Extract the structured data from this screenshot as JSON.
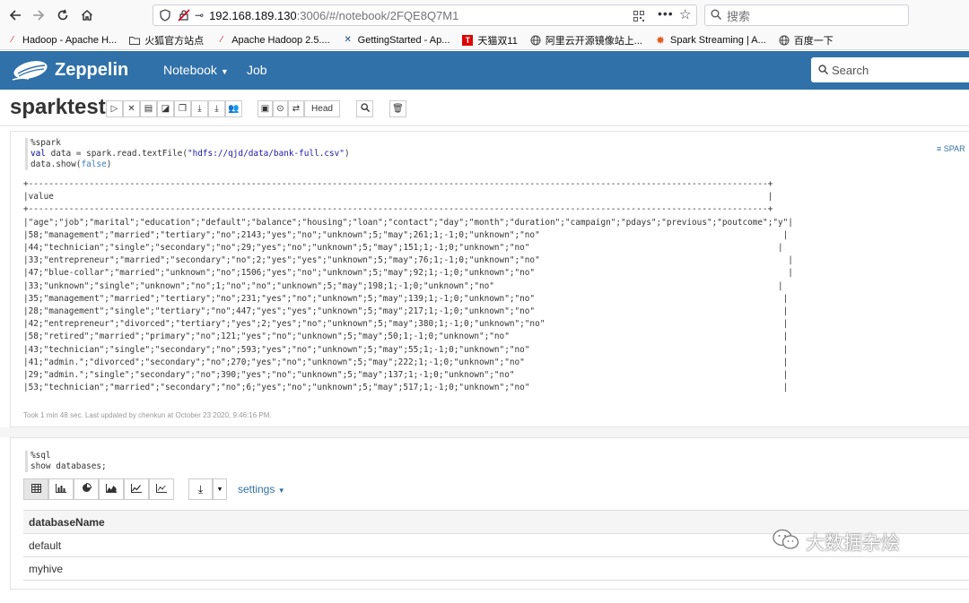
{
  "browser": {
    "url_host": "192.168.189.130",
    "url_path": ":3006/#/notebook/2FQE8Q7M1",
    "search_placeholder": "搜索",
    "bookmarks": [
      {
        "label": "Hadoop - Apache H...",
        "icon": "feather-icon"
      },
      {
        "label": "火狐官方站点",
        "icon": "folder-icon"
      },
      {
        "label": "Apache Hadoop 2.5....",
        "icon": "feather-icon"
      },
      {
        "label": "GettingStarted - Ap...",
        "icon": "x-icon"
      },
      {
        "label": "天猫双11",
        "icon": "tmall-icon"
      },
      {
        "label": "阿里云开源镜像站上...",
        "icon": "globe-icon"
      },
      {
        "label": "Spark Streaming | A...",
        "icon": "spark-icon"
      },
      {
        "label": "百度一下",
        "icon": "globe-icon"
      }
    ]
  },
  "zeppelin": {
    "title": "Zeppelin",
    "nav_notebook": "Notebook",
    "nav_job": "Job",
    "search_placeholder": "Search",
    "brand_color": "#3071a9"
  },
  "notebook": {
    "name": "sparktest",
    "head_button": "Head"
  },
  "para1": {
    "interpreter_label": "SPAR",
    "code": {
      "line1": "%spark",
      "line2_kw": "val",
      "line2_rest": " data = spark.read.textFile(",
      "line2_str": "\"hdfs://qjd/data/bank-full.csv\"",
      "line2_end": ")",
      "line3_pre": "data.show(",
      "line3_kw": "false",
      "line3_end": ")"
    },
    "output_lines": [
      "+--------------------------------------------------------------------------------------------------------------------------------------------------+",
      "|value                                                                                                                                             |",
      "+--------------------------------------------------------------------------------------------------------------------------------------------------+",
      "|\"age\";\"job\";\"marital\";\"education\";\"default\";\"balance\";\"housing\";\"loan\";\"contact\";\"day\";\"month\";\"duration\";\"campaign\";\"pdays\";\"previous\";\"poutcome\";\"y\"|",
      "|58;\"management\";\"married\";\"tertiary\";\"no\";2143;\"yes\";\"no\";\"unknown\";5;\"may\";261;1;-1;0;\"unknown\";\"no\"                                                |",
      "|44;\"technician\";\"single\";\"secondary\";\"no\";29;\"yes\";\"no\";\"unknown\";5;\"may\";151;1;-1;0;\"unknown\";\"no\"                                                 |",
      "|33;\"entrepreneur\";\"married\";\"secondary\";\"no\";2;\"yes\";\"yes\";\"unknown\";5;\"may\";76;1;-1;0;\"unknown\";\"no\"                                                 |",
      "|47;\"blue-collar\";\"married\";\"unknown\";\"no\";1506;\"yes\";\"no\";\"unknown\";5;\"may\";92;1;-1;0;\"unknown\";\"no\"                                                  |",
      "|33;\"unknown\";\"single\";\"unknown\";\"no\";1;\"no\";\"no\";\"unknown\";5;\"may\";198;1;-1;0;\"unknown\";\"no\"                                                        |",
      "|35;\"management\";\"married\";\"tertiary\";\"no\";231;\"yes\";\"no\";\"unknown\";5;\"may\";139;1;-1;0;\"unknown\";\"no\"                                                 |",
      "|28;\"management\";\"single\";\"tertiary\";\"no\";447;\"yes\";\"yes\";\"unknown\";5;\"may\";217;1;-1;0;\"unknown\";\"no\"                                                 |",
      "|42;\"entrepreneur\";\"divorced\";\"tertiary\";\"yes\";2;\"yes\";\"no\";\"unknown\";5;\"may\";380;1;-1;0;\"unknown\";\"no\"                                               |",
      "|58;\"retired\";\"married\";\"primary\";\"no\";121;\"yes\";\"no\";\"unknown\";5;\"may\";50;1;-1;0;\"unknown\";\"no\"                                                      |",
      "|43;\"technician\";\"single\";\"secondary\";\"no\";593;\"yes\";\"no\";\"unknown\";5;\"may\";55;1;-1;0;\"unknown\";\"no\"                                                  |",
      "|41;\"admin.\";\"divorced\";\"secondary\";\"no\";270;\"yes\";\"no\";\"unknown\";5;\"may\";222;1;-1;0;\"unknown\";\"no\"                                                   |",
      "|29;\"admin.\";\"single\";\"secondary\";\"no\";390;\"yes\";\"no\";\"unknown\";5;\"may\";137;1;-1;0;\"unknown\";\"no\"                                                     |",
      "|53;\"technician\";\"married\";\"secondary\";\"no\";6;\"yes\";\"no\";\"unknown\";5;\"may\";517;1;-1;0;\"unknown\";\"no\"                                                  |"
    ],
    "footer": "Took 1 min 48 sec. Last updated by chenkun at October 23 2020, 9:46:16 PM."
  },
  "para2": {
    "code_line1": "%sql",
    "code_line2": "show databases;",
    "settings_label": "settings",
    "table": {
      "header": "databaseName",
      "rows": [
        "default",
        "myhive"
      ]
    }
  },
  "watermark": "大数据杂烩"
}
